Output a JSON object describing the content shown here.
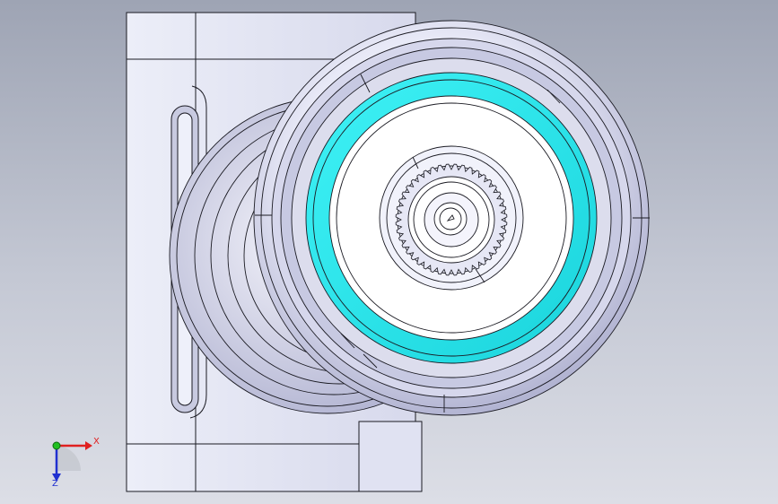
{
  "viewport": {
    "model_description": "cad-assembly-wheel-bracket",
    "background": {
      "top": "#9ea4b4",
      "bottom": "#dcdee6"
    },
    "colors": {
      "part_fill": "#e4e5f4",
      "part_shade": "#b6b8d6",
      "edge": "#1a1a22",
      "highlight_ring": "#29e8ee"
    }
  },
  "triad": {
    "x_label": "X",
    "y_label": "",
    "z_label": "Z",
    "x_color": "#e02020",
    "y_color": "#20c020",
    "z_color": "#2030d0"
  }
}
